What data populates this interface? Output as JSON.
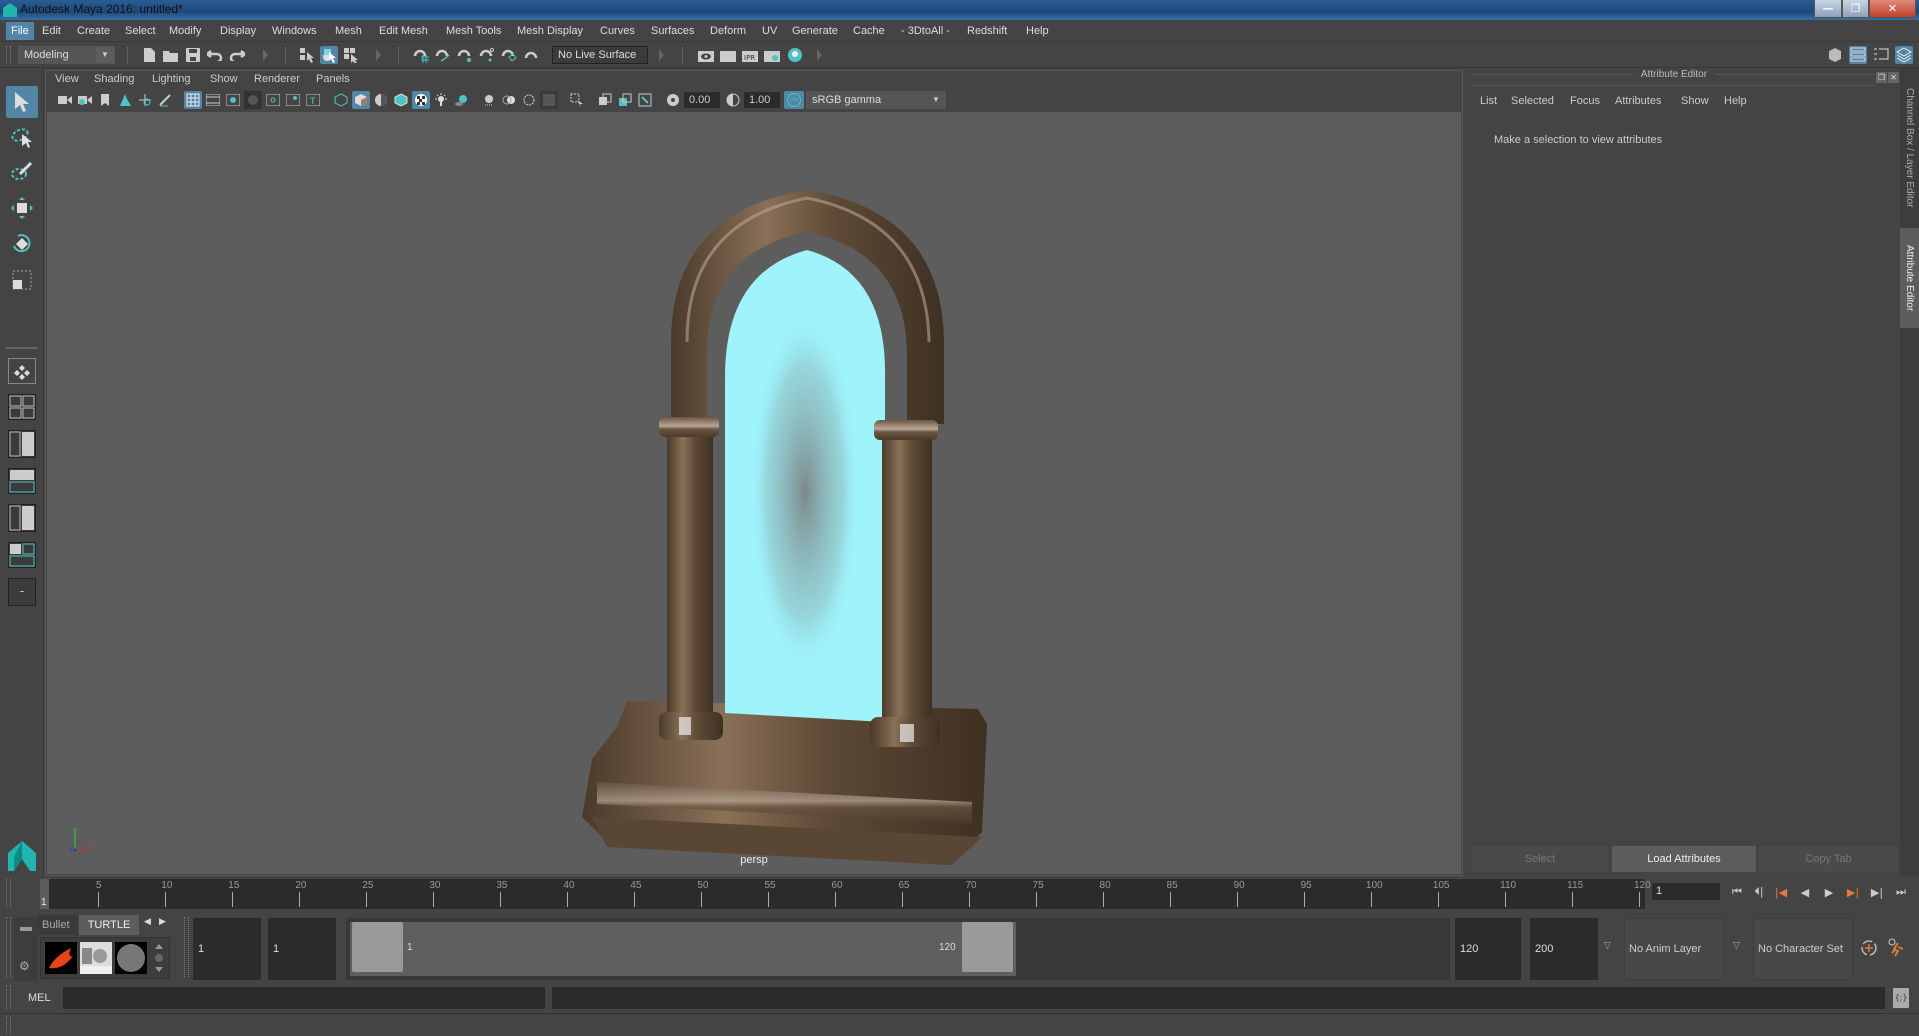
{
  "window": {
    "title": "Autodesk Maya 2016: untitled*",
    "controls": {
      "minimize": "—",
      "restore": "❐",
      "close": "✕"
    }
  },
  "menubar": {
    "items": [
      "File",
      "Edit",
      "Create",
      "Select",
      "Modify",
      "Display",
      "Windows",
      "Mesh",
      "Edit Mesh",
      "Mesh Tools",
      "Mesh Display",
      "Curves",
      "Surfaces",
      "Deform",
      "UV",
      "Generate",
      "Cache",
      "- 3DtoAll -",
      "Redshift",
      "Help"
    ],
    "active": "File"
  },
  "statusline": {
    "menuset": "Modeling",
    "live_surface": "No Live Surface",
    "icons": [
      "new-scene-icon",
      "open-scene-icon",
      "save-scene-icon",
      "undo-icon",
      "redo-icon",
      "select-by-hierarchy-icon",
      "select-by-object-icon",
      "select-by-component-icon",
      "snap-grid-icon",
      "snap-curve-icon",
      "snap-point-icon",
      "snap-view-plane-icon",
      "snap-live-icon",
      "make-live-icon",
      "render-view-icon",
      "render-current-icon",
      "ipr-render-icon",
      "render-settings-icon",
      "hypershade-icon"
    ]
  },
  "right_toggles": [
    "modeling-toolkit-icon",
    "attribute-editor-toggle-icon",
    "tool-settings-toggle-icon",
    "channel-box-toggle-icon"
  ],
  "toolbox": {
    "tools": [
      "select-tool",
      "lasso-tool",
      "paint-select-tool",
      "move-tool",
      "rotate-tool",
      "scale-tool"
    ],
    "layouts": [
      "single-perspective-layout",
      "four-view-layout",
      "persp-outliner-layout",
      "persp-graph-layout",
      "hypershade-layout",
      "persp-graph-hypershade-layout"
    ],
    "more_label": "-"
  },
  "viewport": {
    "menu": [
      "View",
      "Shading",
      "Lighting",
      "Show",
      "Renderer",
      "Panels"
    ],
    "exposure": "0.00",
    "gamma": "1.00",
    "color_space_toggle": "ON",
    "color_space": "sRGB gamma",
    "camera": "persp",
    "axis": {
      "x": "x",
      "y": "y",
      "z": "z"
    }
  },
  "attribute_editor": {
    "title": "Attribute Editor",
    "menu": [
      "List",
      "Selected",
      "Focus",
      "Attributes",
      "Show",
      "Help"
    ],
    "message": "Make a selection to view attributes",
    "buttons": {
      "select": "Select",
      "load": "Load Attributes",
      "copy": "Copy Tab"
    }
  },
  "side_tabs": {
    "channel_box": "Channel Box / Layer Editor",
    "attribute_editor": "Attribute Editor"
  },
  "timeline": {
    "ticks": [
      5,
      10,
      15,
      20,
      25,
      30,
      35,
      40,
      45,
      50,
      55,
      60,
      65,
      70,
      75,
      80,
      85,
      90,
      95,
      100,
      105,
      110,
      115,
      120
    ],
    "start": 1,
    "end": 120,
    "current_frame": "1",
    "current_marker": "1"
  },
  "range": {
    "shelf_tabs": [
      "Bullet",
      "TURTLE"
    ],
    "start_time": "1",
    "playback_start": "1",
    "range_start_label": "1",
    "range_end_label": "120",
    "playback_end": "120",
    "end_time": "200",
    "anim_layer": "No Anim Layer",
    "character_set": "No Character Set"
  },
  "command_line": {
    "label": "MEL",
    "input": "",
    "result": ""
  },
  "colors": {
    "accent": "#5285a6",
    "portal": "#9ff3fb",
    "stone": "#6b5540"
  }
}
